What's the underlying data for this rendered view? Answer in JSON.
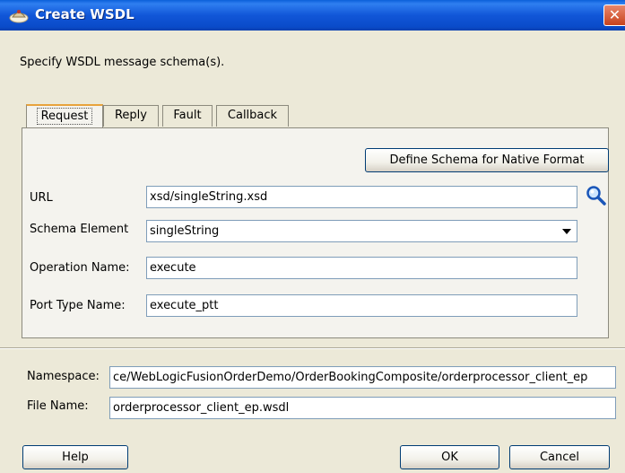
{
  "window": {
    "title": "Create WSDL",
    "close_glyph": "✕"
  },
  "instruction": "Specify WSDL message schema(s).",
  "tabs": [
    {
      "label": "Request",
      "active": true
    },
    {
      "label": "Reply",
      "active": false
    },
    {
      "label": "Fault",
      "active": false
    },
    {
      "label": "Callback",
      "active": false
    }
  ],
  "request": {
    "define_schema_label": "Define Schema for Native Format",
    "url": {
      "label": "URL",
      "value": "xsd/singleString.xsd"
    },
    "schema_element": {
      "label": "Schema Element",
      "value": "singleString"
    },
    "operation_name": {
      "label": "Operation Name:",
      "value": "execute"
    },
    "port_type_name": {
      "label": "Port Type Name:",
      "value": "execute_ptt"
    }
  },
  "namespace": {
    "label": "Namespace:",
    "value": "ce/WebLogicFusionOrderDemo/OrderBookingComposite/orderprocessor_client_ep"
  },
  "file_name": {
    "label": "File Name:",
    "value": "orderprocessor_client_ep.wsdl"
  },
  "buttons": {
    "help": "Help",
    "ok": "OK",
    "cancel": "Cancel"
  },
  "icons": {
    "title": "dialog-app-icon",
    "search": "search-icon"
  }
}
